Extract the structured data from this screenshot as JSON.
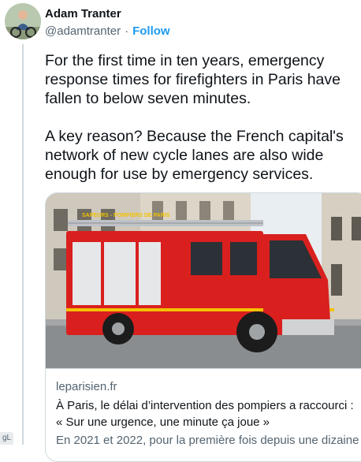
{
  "author": {
    "display_name": "Adam Tranter",
    "handle": "@adamtranter",
    "separator": "·",
    "follow_label": "Follow"
  },
  "tweet": {
    "text": "For the first time in ten years, emergency response times for firefighters in Paris have fallen to below seven minutes.\n\nA key reason? Because the French capital's network of new cycle lanes are also wide enough for use by emergency services."
  },
  "card": {
    "image_alt": "Red Sapeurs-Pompiers de Paris fire engine parked on a Paris street",
    "truck_lettering": "SAPEURS - POMPIERS DE PARIS",
    "domain": "leparisien.fr",
    "title_line1": "À Paris, le délai d’intervention des pompiers a raccourci :",
    "title_line2": "« Sur une urgence, une minute ça joue »",
    "description": "En 2021 et 2022, pour la première fois depuis une dizaine ..."
  },
  "corner_badge": "gL",
  "colors": {
    "link": "#1d9bf0",
    "muted": "#536471",
    "border": "#cfd9de",
    "truck_red": "#d9201e"
  },
  "icons": {
    "avatar": "profile-photo-cyclist"
  }
}
